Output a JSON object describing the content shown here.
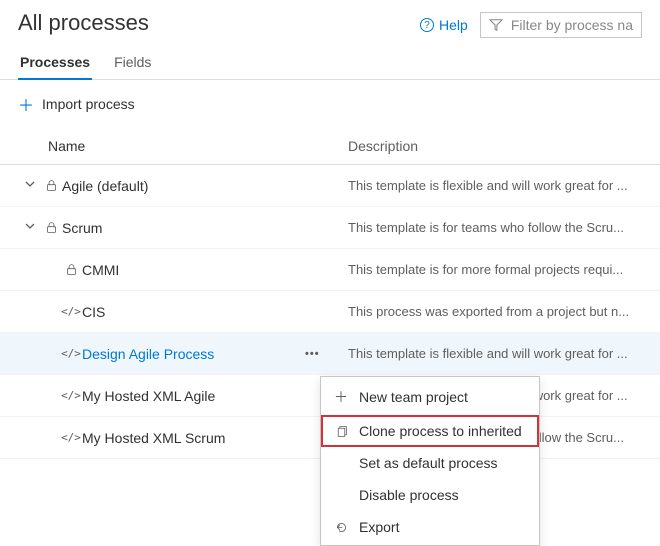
{
  "header": {
    "title": "All processes",
    "help_label": "Help",
    "filter_placeholder": "Filter by process na"
  },
  "tabs": [
    {
      "label": "Processes",
      "active": true
    },
    {
      "label": "Fields",
      "active": false
    }
  ],
  "actions": {
    "import_label": "Import process"
  },
  "columns": {
    "name": "Name",
    "description": "Description"
  },
  "rows": [
    {
      "name": "Agile (default)",
      "desc": "This template is flexible and will work great for ...",
      "icon": "lock",
      "expandable": true,
      "indent": 0
    },
    {
      "name": "Scrum",
      "desc": "This template is for teams who follow the Scru...",
      "icon": "lock",
      "expandable": true,
      "indent": 0
    },
    {
      "name": "CMMI",
      "desc": "This template is for more formal projects requi...",
      "icon": "lock",
      "expandable": false,
      "indent": 1
    },
    {
      "name": "CIS",
      "desc": "This process was exported from a project but n...",
      "icon": "code",
      "expandable": false,
      "indent": 1
    },
    {
      "name": "Design Agile Process",
      "desc": "This template is flexible and will work great for ...",
      "icon": "code",
      "expandable": false,
      "indent": 1,
      "selected": true,
      "link": true
    },
    {
      "name": "My Hosted XML Agile",
      "desc": "This template is flexible and will work great for ...",
      "icon": "code",
      "expandable": false,
      "indent": 1
    },
    {
      "name": "My Hosted XML Scrum",
      "desc": "This template is for teams who follow the Scru...",
      "icon": "code",
      "expandable": false,
      "indent": 1
    }
  ],
  "context_menu": [
    {
      "label": "New team project",
      "icon": "plus"
    },
    {
      "label": "Clone process to inherited",
      "icon": "copy",
      "highlighted": true
    },
    {
      "label": "Set as default process",
      "icon": ""
    },
    {
      "label": "Disable process",
      "icon": ""
    },
    {
      "label": "Export",
      "icon": "export"
    }
  ]
}
